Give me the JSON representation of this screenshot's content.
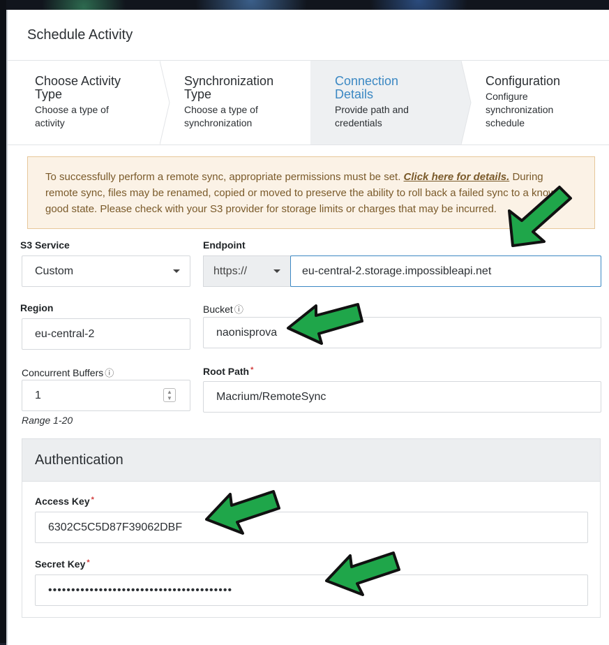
{
  "dialog": {
    "title": "Schedule Activity"
  },
  "steps": [
    {
      "title": "Choose Activity Type",
      "title_l1": "Choose Activity",
      "title_l2": "Type",
      "sub_l1": "Choose a type of",
      "sub_l2": "activity"
    },
    {
      "title": "Synchronization Type",
      "title_l1": "Synchronization",
      "title_l2": "Type",
      "sub_l1": "Choose a type of",
      "sub_l2": "synchronization"
    },
    {
      "title": "Connection Details",
      "title_l1": "Connection",
      "title_l2": "Details",
      "sub_l1": "Provide path and",
      "sub_l2": "credentials",
      "active": true
    },
    {
      "title": "Configuration",
      "title_l1": "Configuration",
      "sub_l1": "Configure",
      "sub_l2": "synchronization",
      "sub_l3": "schedule"
    }
  ],
  "notice": {
    "text_before": "To successfully perform a remote sync, appropriate permissions must be set. ",
    "link": "Click here for details.",
    "text_after": " During remote sync, files may be renamed, copied or moved to preserve the ability to roll back a failed sync to a known good state. Please check with your S3 provider for storage limits or charges that may be incurred."
  },
  "form": {
    "s3_service": {
      "label": "S3 Service",
      "value": "Custom"
    },
    "endpoint": {
      "label": "Endpoint",
      "protocol": "https://",
      "value": "eu-central-2.storage.impossibleapi.net"
    },
    "region": {
      "label": "Region",
      "value": "eu-central-2"
    },
    "bucket": {
      "label": "Bucket",
      "value": "naonisprova"
    },
    "buffers": {
      "label": "Concurrent Buffers",
      "value": "1",
      "range": "Range 1-20"
    },
    "root_path": {
      "label": "Root Path",
      "value": "Macrium/RemoteSync"
    }
  },
  "auth": {
    "title": "Authentication",
    "access_key": {
      "label": "Access Key",
      "value": "6302C5C5D87F39062DBF"
    },
    "secret_key": {
      "label": "Secret Key",
      "value": "••••••••••••••••••••••••••••••••••••••••"
    }
  },
  "colors": {
    "accent": "#3b88c3",
    "required": "#d23b3b",
    "arrow_fill": "#1fa64a",
    "arrow_stroke": "#111111",
    "notice_bg": "#fbf2e6"
  }
}
